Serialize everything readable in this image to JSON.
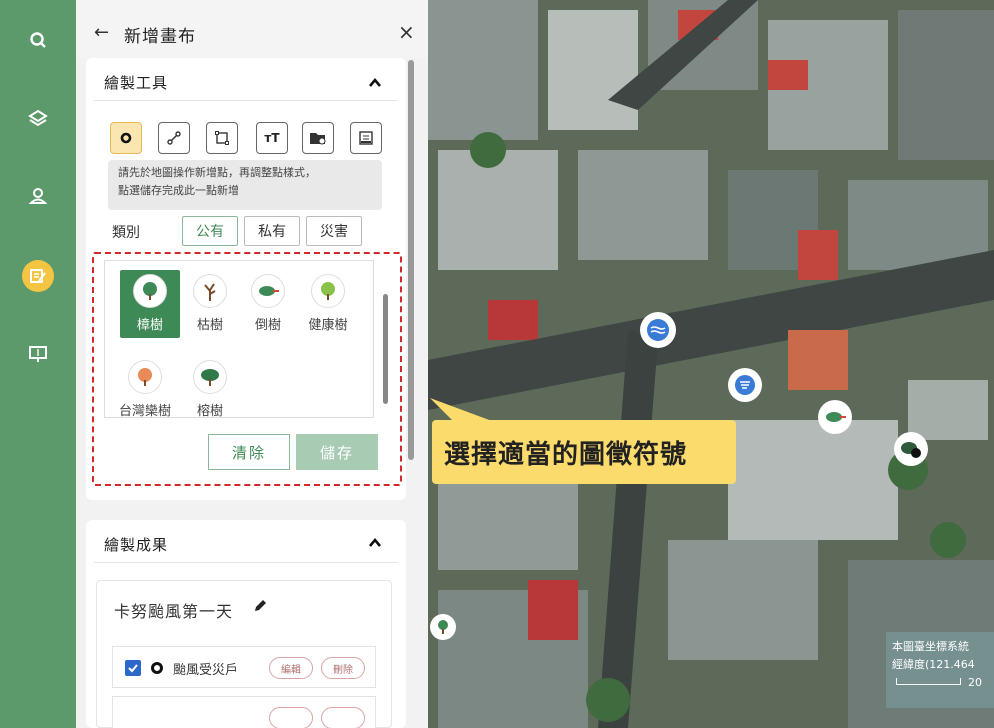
{
  "rail": {
    "items": [
      {
        "icon": "search-icon"
      },
      {
        "icon": "layers-icon"
      },
      {
        "icon": "location-user-icon"
      },
      {
        "icon": "edit-canvas-icon",
        "active": true
      },
      {
        "icon": "presentation-icon"
      }
    ]
  },
  "panel": {
    "back_label": "←",
    "title": "新增畫布",
    "close_label": "×",
    "draw_tools": {
      "heading": "繪製工具",
      "tools": [
        "point",
        "line",
        "polygon",
        "text",
        "folder",
        "layer"
      ],
      "hint_line1": "請先於地圖操作新增點，再調整點樣式，",
      "hint_line2": "點選儲存完成此一點新增",
      "category_label": "類別",
      "categories": [
        "公有",
        "私有",
        "災害"
      ],
      "active_category": "公有",
      "trees_row1": [
        "樟樹",
        "枯樹",
        "倒樹",
        "健康樹"
      ],
      "trees_row2": [
        "台灣欒樹",
        "榕樹"
      ],
      "selected_tree": "樟樹",
      "clear_label": "清除",
      "save_label": "儲存"
    },
    "results": {
      "heading": "繪製成果",
      "event_name": "卡努颱風第一天",
      "row_label": "颱風受災戶",
      "edit_label": "編輯",
      "delete_label": "刪除"
    }
  },
  "map": {
    "callout": "選擇適當的圖徵符號",
    "coord_line1": "本圖臺坐標系統",
    "coord_line2": "經緯度(121.464",
    "scale_label": "20",
    "accent": "#fbdb6b"
  },
  "colors": {
    "rail": "#5c9a6c",
    "primary": "#3e8a57",
    "dashed": "#d12a2a"
  }
}
